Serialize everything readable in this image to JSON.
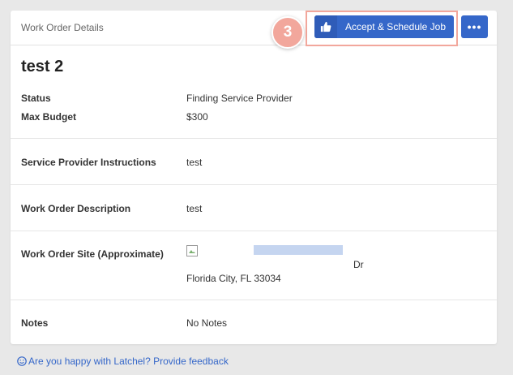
{
  "header": {
    "title": "Work Order Details",
    "accept_label": "Accept & Schedule Job",
    "more_label": "•••",
    "step_number": "3"
  },
  "work_order": {
    "title": "test 2",
    "fields": [
      {
        "label": "Status",
        "value": "Finding Service Provider"
      },
      {
        "label": "Max Budget",
        "value": "$300"
      },
      {
        "label": "Service Provider Instructions",
        "value": "test"
      },
      {
        "label": "Work Order Description",
        "value": "test"
      },
      {
        "label": "Work Order Site (Approximate)",
        "value_line1_end": "Dr",
        "value_line2": "Florida City, FL 33034"
      },
      {
        "label": "Notes",
        "value": "No Notes"
      }
    ]
  },
  "footer": {
    "feedback_text": "Are you happy with Latchel? Provide feedback"
  },
  "colors": {
    "accent": "#3567c9",
    "step_badge": "#f2a79c"
  }
}
